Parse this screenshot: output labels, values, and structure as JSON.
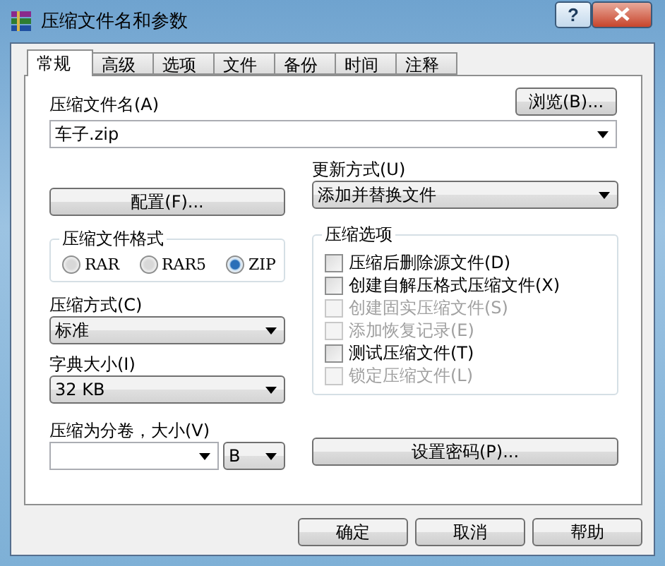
{
  "window": {
    "title": "压缩文件名和参数",
    "help_button": "?"
  },
  "tabs": [
    {
      "label": "常规",
      "selected": true
    },
    {
      "label": "高级",
      "selected": false
    },
    {
      "label": "选项",
      "selected": false
    },
    {
      "label": "文件",
      "selected": false
    },
    {
      "label": "备份",
      "selected": false
    },
    {
      "label": "时间",
      "selected": false
    },
    {
      "label": "注释",
      "selected": false
    }
  ],
  "archive_name": {
    "label": "压缩文件名(A)",
    "value": "车子.zip",
    "browse_button": "浏览(B)..."
  },
  "profiles_button": "配置(F)...",
  "update_mode": {
    "label": "更新方式(U)",
    "value": "添加并替换文件"
  },
  "archive_format": {
    "title": "压缩文件格式",
    "options": [
      {
        "label": "RAR",
        "selected": false
      },
      {
        "label": "RAR5",
        "selected": false
      },
      {
        "label": "ZIP",
        "selected": true
      }
    ]
  },
  "compression_method": {
    "label": "压缩方式(C)",
    "value": "标准"
  },
  "dictionary_size": {
    "label": "字典大小(I)",
    "value": "32 KB"
  },
  "split_volumes": {
    "label": "压缩为分卷，大小(V)",
    "unit": "B"
  },
  "compression_options": {
    "title": "压缩选项",
    "items": [
      {
        "label": "压缩后删除源文件(D)",
        "checked": false,
        "disabled": false
      },
      {
        "label": "创建自解压格式压缩文件(X)",
        "checked": false,
        "disabled": false
      },
      {
        "label": "创建固实压缩文件(S)",
        "checked": false,
        "disabled": true
      },
      {
        "label": "添加恢复记录(E)",
        "checked": false,
        "disabled": true
      },
      {
        "label": "测试压缩文件(T)",
        "checked": false,
        "disabled": false
      },
      {
        "label": "锁定压缩文件(L)",
        "checked": false,
        "disabled": true
      }
    ]
  },
  "password_button": "设置密码(P)...",
  "buttons": [
    "确定",
    "取消",
    "帮助"
  ]
}
